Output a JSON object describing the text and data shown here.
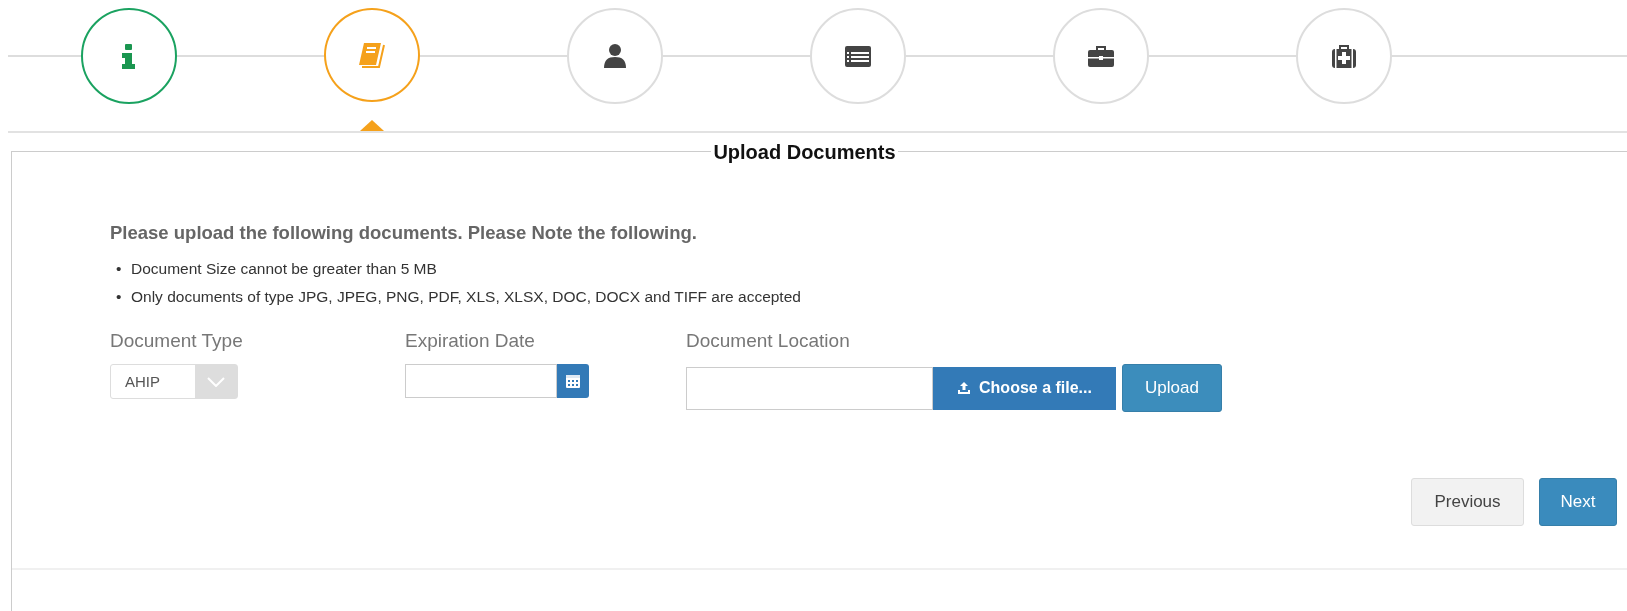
{
  "steps": [
    {
      "kind": "info",
      "completed": true,
      "selected": false
    },
    {
      "kind": "book",
      "completed": false,
      "selected": true
    },
    {
      "kind": "person",
      "completed": false,
      "selected": false
    },
    {
      "kind": "list",
      "completed": false,
      "selected": false
    },
    {
      "kind": "briefcase",
      "completed": false,
      "selected": false
    },
    {
      "kind": "medkit",
      "completed": false,
      "selected": false
    }
  ],
  "section": {
    "title": "Upload Documents",
    "intro": "Please upload the following documents. Please Note the following.",
    "notes": [
      {
        "bullet": "•",
        "text": "Document Size cannot be greater than 5 MB"
      },
      {
        "bullet": "•",
        "text": "Only documents of type JPG, JPEG, PNG, PDF, XLS, XLSX, DOC, DOCX and TIFF are accepted"
      }
    ],
    "document_type": {
      "label": "Document Type",
      "value": "AHIP"
    },
    "expiration_date": {
      "label": "Expiration Date"
    },
    "document_location": {
      "label": "Document Location",
      "choose_button": "Choose a file...",
      "upload_button": "Upload"
    },
    "buttons": {
      "previous": "Previous",
      "next": "Next"
    }
  }
}
